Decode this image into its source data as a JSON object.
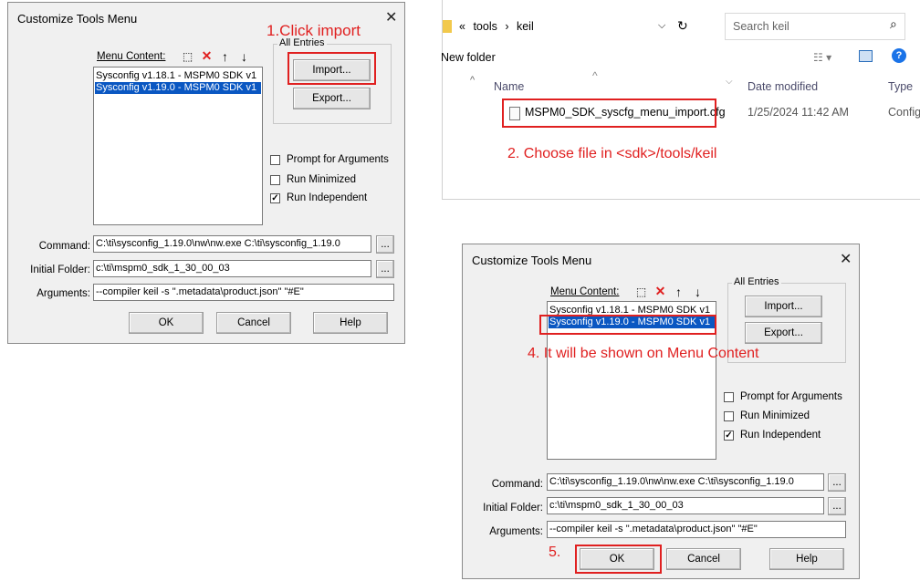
{
  "dialog_title": "Customize Tools Menu",
  "close_glyph": "✕",
  "menu_content_label": "Menu Content:",
  "menu_items": [
    "Sysconfig v1.18.1 - MSPM0 SDK v1",
    "Sysconfig v1.19.0 - MSPM0 SDK v1"
  ],
  "all_entries_label": "All Entries",
  "import_label": "Import...",
  "export_label": "Export...",
  "prompt_label": "Prompt for Arguments",
  "minimized_label": "Run Minimized",
  "independent_label": "Run Independent",
  "command_label": "Command:",
  "command_value": "C:\\ti\\sysconfig_1.19.0\\nw\\nw.exe C:\\ti\\sysconfig_1.19.0",
  "initial_folder_label": "Initial Folder:",
  "initial_folder_value": "c:\\ti\\mspm0_sdk_1_30_00_03",
  "arguments_label": "Arguments:",
  "arguments_value": "--compiler keil -s \".metadata\\product.json\" \"#E\"",
  "browse_label": "...",
  "ok_label": "OK",
  "cancel_label": "Cancel",
  "help_label": "Help",
  "check_mark": "✓",
  "annotations": {
    "step1": "1.Click import",
    "step2": "2. Choose file in <sdk>/tools/keil",
    "step4": "4. It will be shown on Menu Content",
    "step5": "5."
  },
  "explorer": {
    "breadcrumb": [
      "«",
      "tools",
      "›",
      "keil"
    ],
    "search_placeholder": "Search keil",
    "new_folder": "New folder",
    "columns": {
      "name": "Name",
      "date": "Date modified",
      "type": "Type"
    },
    "file": {
      "name": "MSPM0_SDK_syscfg_menu_import.cfg",
      "date": "1/25/2024 11:42 AM",
      "type": "Configu"
    }
  },
  "colors": {
    "highlight": "#0a57c2",
    "annotation": "#e02020"
  }
}
